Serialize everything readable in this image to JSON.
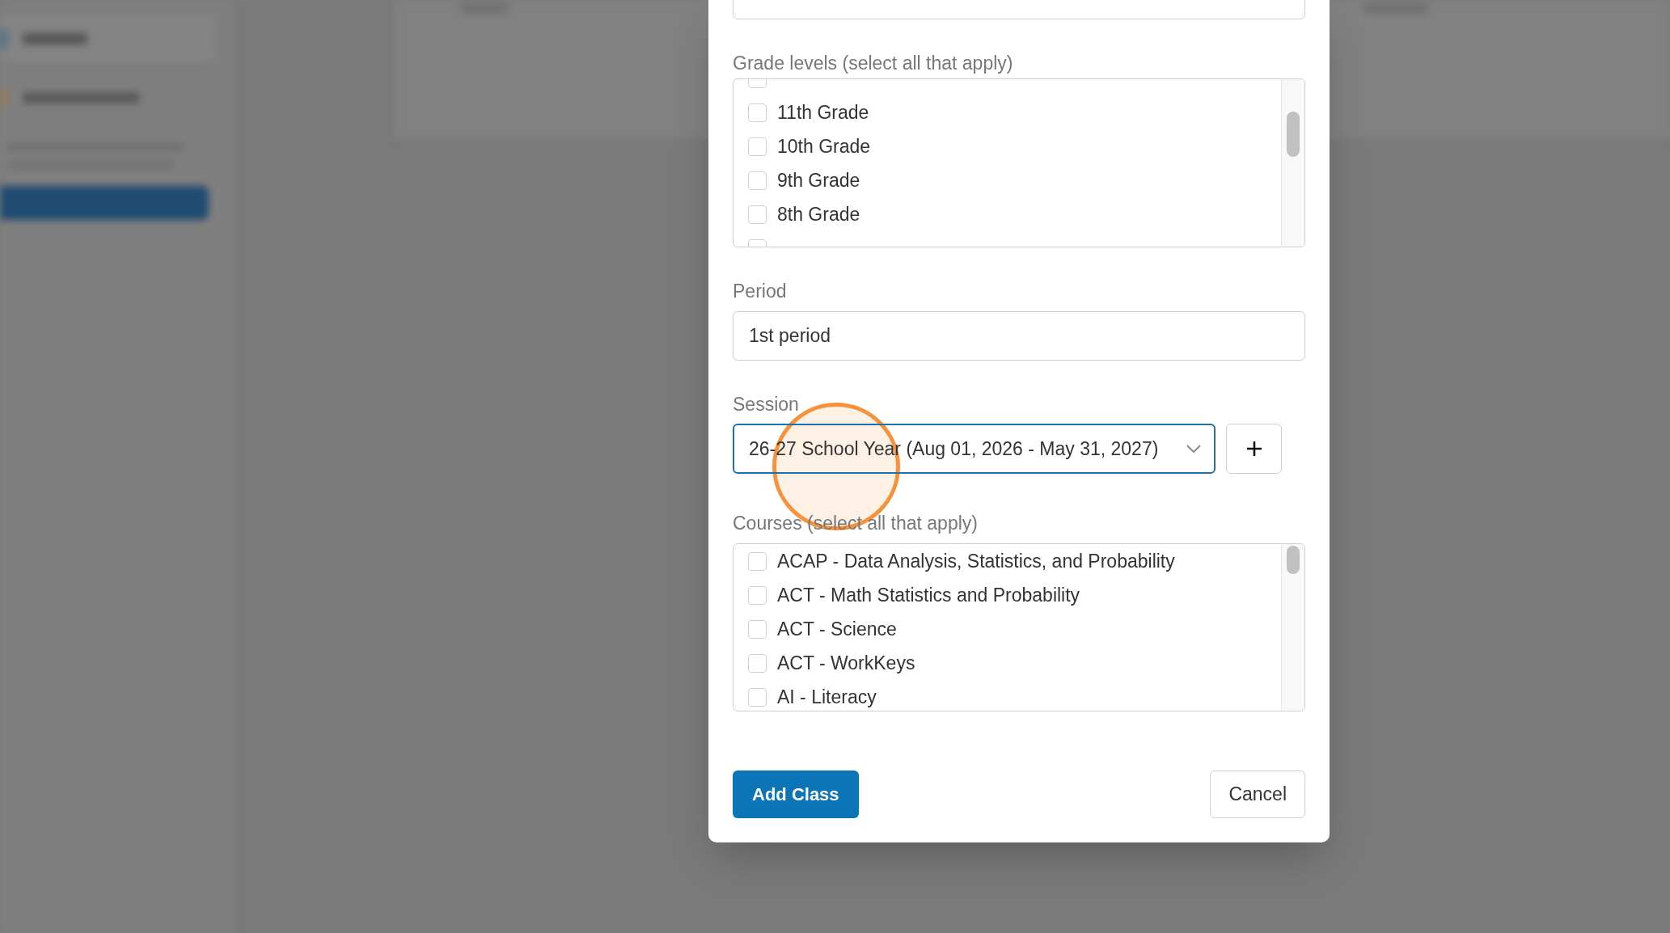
{
  "dialog": {
    "grade_levels": {
      "label": "Grade levels (select all that apply)",
      "options": [
        {
          "checked": false
        },
        {
          "label": "11th Grade",
          "checked": false
        },
        {
          "label": "10th Grade",
          "checked": false
        },
        {
          "label": "9th Grade",
          "checked": false
        },
        {
          "label": "8th Grade",
          "checked": false
        },
        {
          "checked": false
        }
      ]
    },
    "period": {
      "label": "Period",
      "value": "1st period"
    },
    "session": {
      "label": "Session",
      "value": "26-27 School Year (Aug 01, 2026 - May 31, 2027)",
      "focused": true
    },
    "courses": {
      "label": "Courses (select all that apply)",
      "options": [
        {
          "label": "ACAP - Data Analysis, Statistics, and Probability",
          "checked": false
        },
        {
          "label": "ACT - Math Statistics and Probability",
          "checked": false
        },
        {
          "label": "ACT - Science",
          "checked": false
        },
        {
          "label": "ACT - WorkKeys",
          "checked": false
        },
        {
          "label": "AI - Literacy",
          "checked": false
        }
      ]
    },
    "buttons": [
      {
        "label": "Add Class",
        "kind": "primary"
      },
      {
        "label": "Cancel",
        "kind": "secondary"
      }
    ]
  }
}
